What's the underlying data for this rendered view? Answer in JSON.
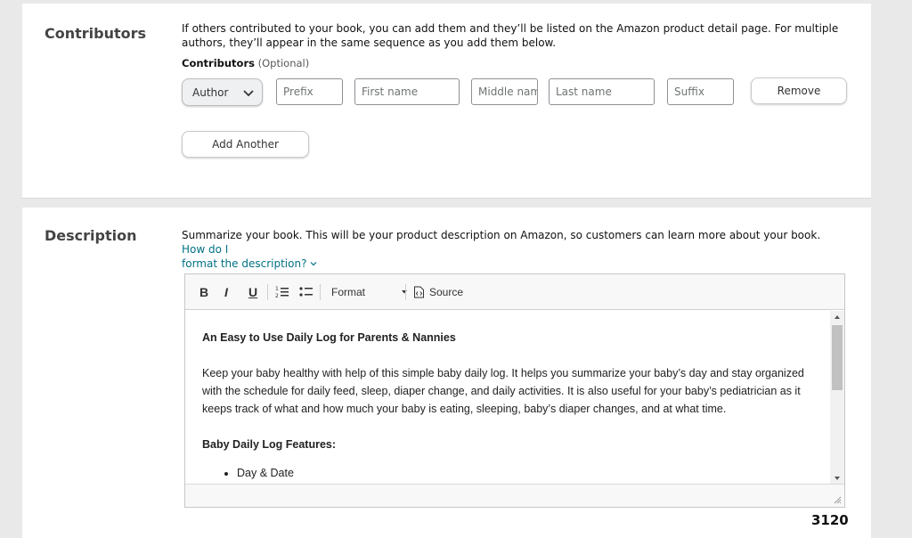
{
  "contributors": {
    "title": "Contributors",
    "help_text_line1": "If others contributed to your book, you can add them and they’ll be listed on the Amazon product detail page. For multiple",
    "help_text_line2": "authors, they’ll appear in the same sequence as you add them below.",
    "field_label": "Contributors",
    "optional_label": "(Optional)",
    "role_select_value": "Author",
    "prefix_placeholder": "Prefix",
    "first_name_placeholder": "First name",
    "middle_name_placeholder": "Middle name",
    "last_name_placeholder": "Last name",
    "suffix_placeholder": "Suffix",
    "remove_label": "Remove",
    "add_another_label": "Add Another"
  },
  "description": {
    "title": "Description",
    "help_text": "Summarize your book. This will be your product description on Amazon, so customers can learn more about your book.",
    "help_link_part1": "How do I",
    "help_link_part2": "format the description?",
    "toolbar": {
      "bold": "B",
      "italic": "I",
      "underline": "U",
      "format_label": "Format",
      "source_label": "Source"
    },
    "content": {
      "heading": "An Easy to Use Daily Log for Parents & Nannies",
      "paragraph_line1": "Keep your baby healthy with help of this simple baby daily log. It helps you summarize your baby’s day and stay organized",
      "paragraph_line2": "with the schedule for daily feed, sleep, diaper change, and daily activities. It is also useful for your baby’s pediatrician as it",
      "paragraph_line3": "keeps track of what and how much your baby is eating, sleeping, baby’s diaper changes, and at what time.",
      "features_heading": "Baby Daily Log Features:",
      "features": [
        "Day & Date"
      ]
    },
    "character_count": "3120"
  },
  "colors": {
    "page_background": "#e9e9e9",
    "link": "#007185",
    "section_title": "#444444"
  }
}
